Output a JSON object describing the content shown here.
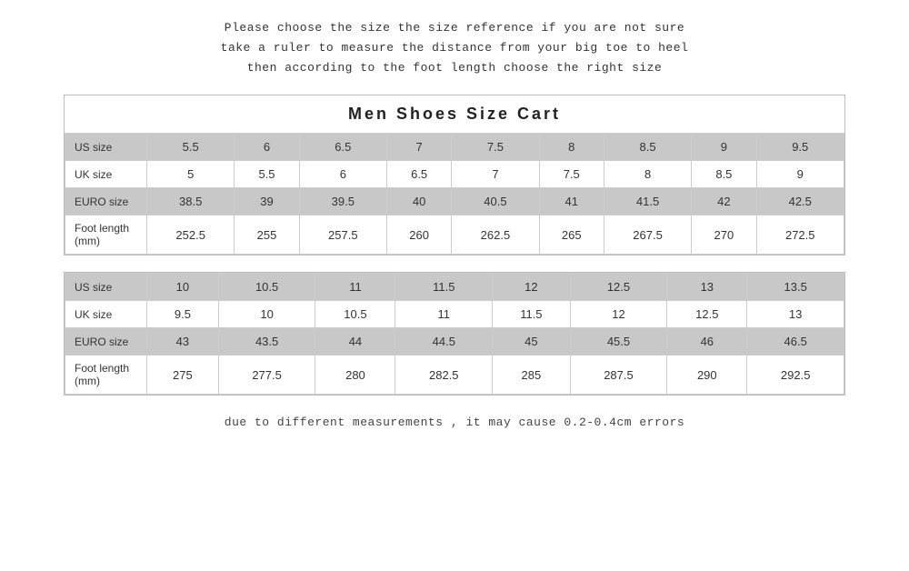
{
  "instructions": {
    "line1": "Please choose the size the size reference if you are not sure",
    "line2": "take a ruler to measure the distance from your big toe to heel",
    "line3": "then  according  to  the foot length  choose  the right size"
  },
  "table1": {
    "title": "Men   Shoes   Size   Cart",
    "rows": [
      {
        "label": "US size",
        "values": [
          "5.5",
          "6",
          "6.5",
          "7",
          "7.5",
          "8",
          "8.5",
          "9",
          "9.5"
        ],
        "shaded": true
      },
      {
        "label": "UK size",
        "values": [
          "5",
          "5.5",
          "6",
          "6.5",
          "7",
          "7.5",
          "8",
          "8.5",
          "9"
        ],
        "shaded": false
      },
      {
        "label": "EURO size",
        "values": [
          "38.5",
          "39",
          "39.5",
          "40",
          "40.5",
          "41",
          "41.5",
          "42",
          "42.5"
        ],
        "shaded": true
      },
      {
        "label": "Foot length (mm)",
        "values": [
          "252.5",
          "255",
          "257.5",
          "260",
          "262.5",
          "265",
          "267.5",
          "270",
          "272.5"
        ],
        "shaded": false
      }
    ]
  },
  "table2": {
    "rows": [
      {
        "label": "US size",
        "values": [
          "10",
          "10.5",
          "11",
          "11.5",
          "12",
          "12.5",
          "13",
          "13.5"
        ],
        "shaded": true
      },
      {
        "label": "UK size",
        "values": [
          "9.5",
          "10",
          "10.5",
          "11",
          "11.5",
          "12",
          "12.5",
          "13"
        ],
        "shaded": false
      },
      {
        "label": "EURO size",
        "values": [
          "43",
          "43.5",
          "44",
          "44.5",
          "45",
          "45.5",
          "46",
          "46.5"
        ],
        "shaded": true
      },
      {
        "label": "Foot length (mm)",
        "values": [
          "275",
          "277.5",
          "280",
          "282.5",
          "285",
          "287.5",
          "290",
          "292.5"
        ],
        "shaded": false
      }
    ]
  },
  "footer": "due to different measurements , it may cause 0.2-0.4cm errors"
}
